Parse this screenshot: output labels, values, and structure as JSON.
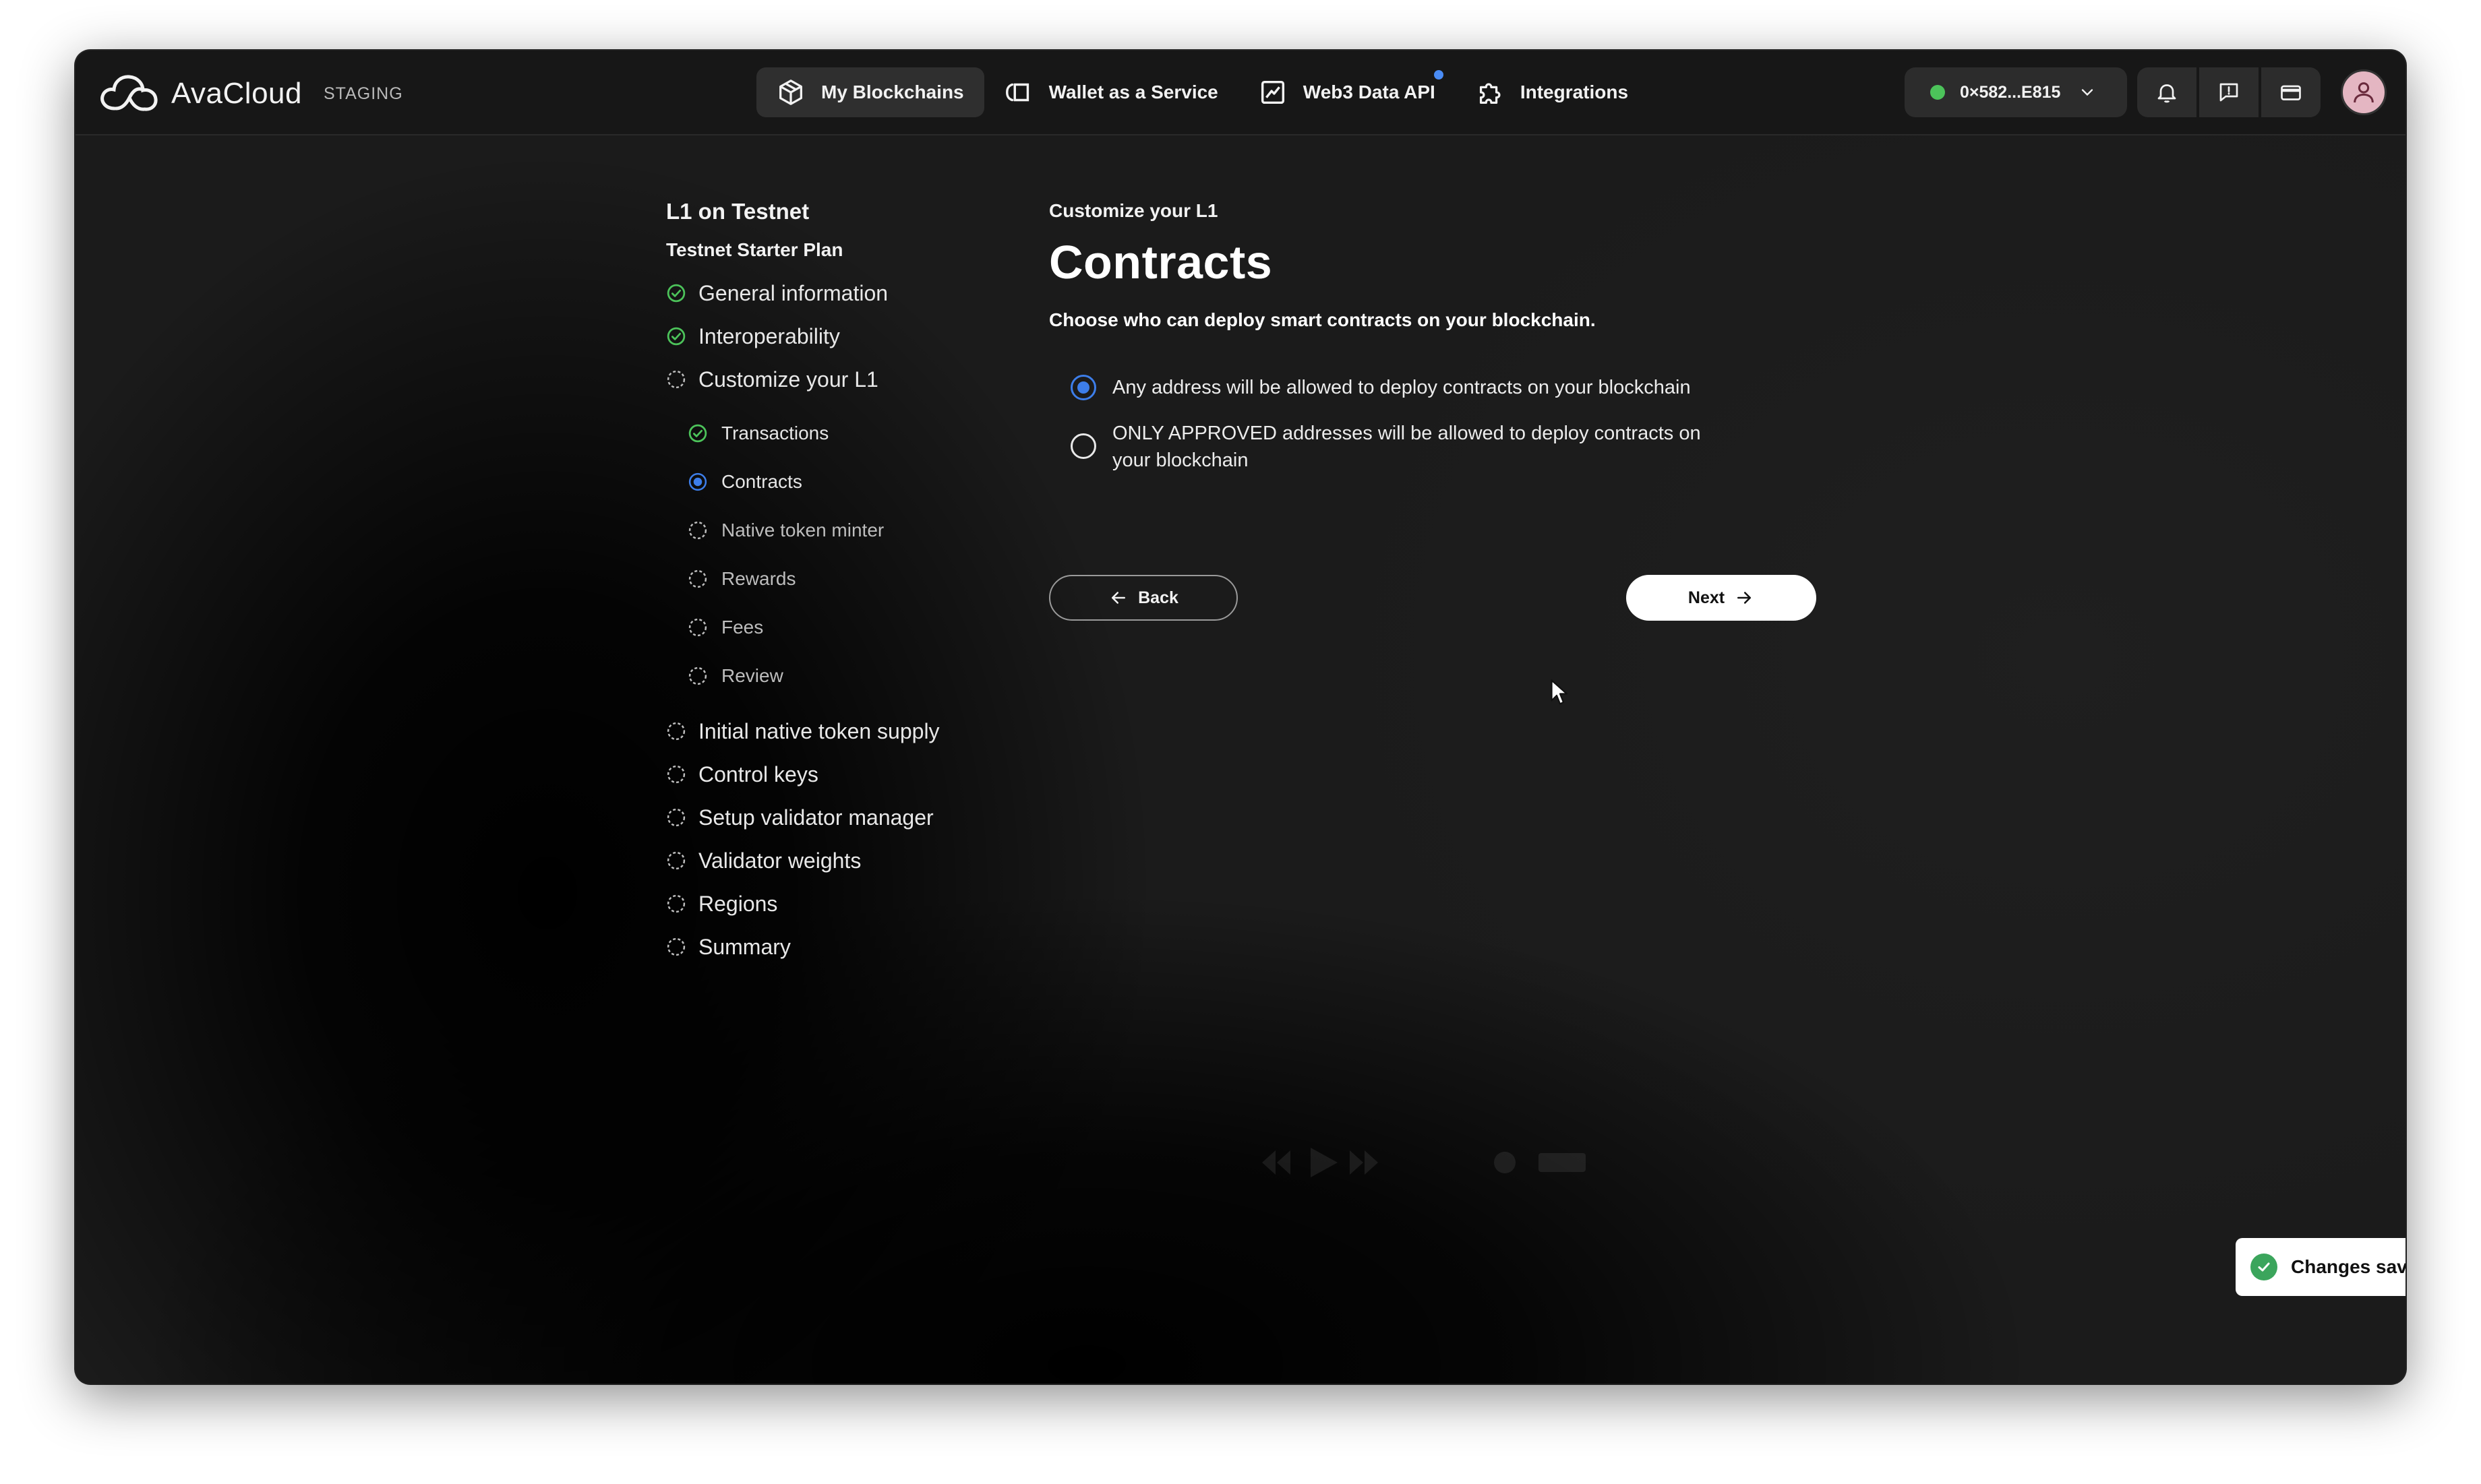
{
  "app": {
    "name": "AvaCloud",
    "environment": "STAGING"
  },
  "nav": {
    "items": [
      {
        "label": "My Blockchains",
        "icon": "cube-icon",
        "active": true
      },
      {
        "label": "Wallet as a Service",
        "icon": "wallet-icon",
        "active": false
      },
      {
        "label": "Web3 Data API",
        "icon": "chart-icon",
        "active": false,
        "has_dot": true
      },
      {
        "label": "Integrations",
        "icon": "puzzle-icon",
        "active": false
      }
    ]
  },
  "wallet": {
    "address": "0×582...E815",
    "status_color": "#4cc35a"
  },
  "toolbar_icons": [
    "bell-icon",
    "feedback-icon",
    "card-icon",
    "avatar"
  ],
  "stepper": {
    "title": "L1 on Testnet",
    "plan": "Testnet Starter Plan",
    "steps_top": [
      {
        "label": "General information",
        "status": "complete"
      },
      {
        "label": "Interoperability",
        "status": "complete"
      },
      {
        "label": "Customize your L1",
        "status": "in-progress"
      }
    ],
    "substeps": [
      {
        "label": "Transactions",
        "status": "complete"
      },
      {
        "label": "Contracts",
        "status": "current"
      },
      {
        "label": "Native token minter",
        "status": "pending"
      },
      {
        "label": "Rewards",
        "status": "pending"
      },
      {
        "label": "Fees",
        "status": "pending"
      },
      {
        "label": "Review",
        "status": "pending"
      }
    ],
    "steps_bottom": [
      {
        "label": "Initial native token supply",
        "status": "pending"
      },
      {
        "label": "Control keys",
        "status": "pending"
      },
      {
        "label": "Setup validator manager",
        "status": "pending"
      },
      {
        "label": "Validator weights",
        "status": "pending"
      },
      {
        "label": "Regions",
        "status": "pending"
      },
      {
        "label": "Summary",
        "status": "pending"
      }
    ]
  },
  "form": {
    "eyebrow": "Customize your L1",
    "title": "Contracts",
    "description": "Choose who can deploy smart contracts on your blockchain.",
    "options": [
      {
        "label": "Any address will be allowed to deploy contracts on your blockchain",
        "selected": true
      },
      {
        "label": "ONLY APPROVED addresses will be allowed to deploy contracts on your blockchain",
        "selected": false
      }
    ],
    "back_label": "Back",
    "next_label": "Next"
  },
  "toast": {
    "message": "Changes saved"
  },
  "colors": {
    "accent": "#3d7eea",
    "success": "#4cc35a",
    "background": "#1b1b1b"
  }
}
